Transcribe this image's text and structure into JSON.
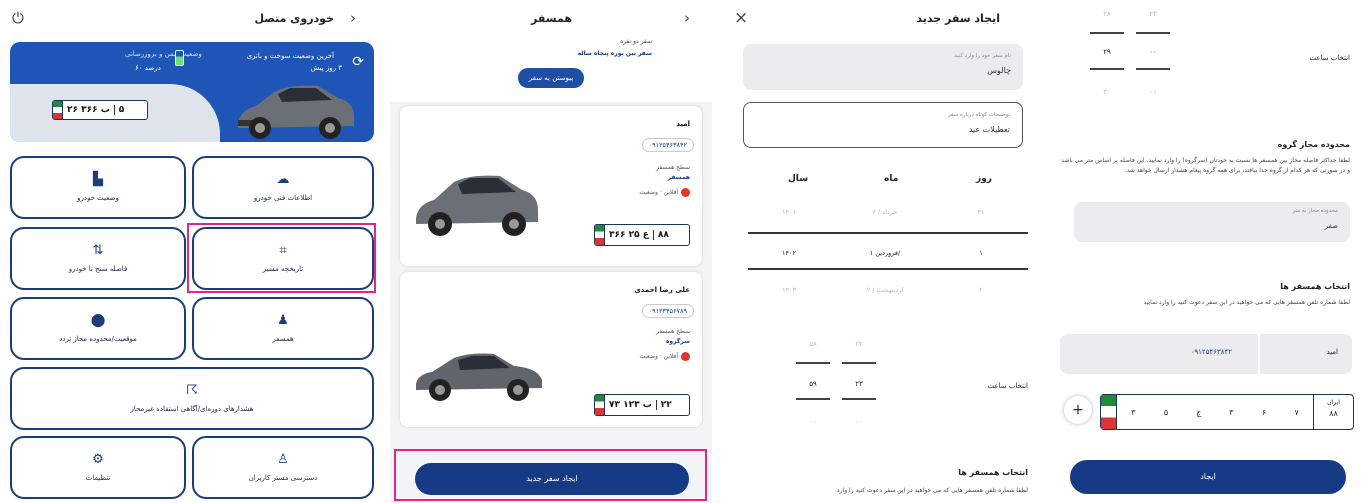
{
  "panel1": {
    "title": "خودروی متصل",
    "banner": {
      "fuel_label": "آخرین وضعیت سوخت و باتری",
      "model": "۳ روز پیش",
      "status": "وضعیت ایمن و بروزرسانی",
      "percent": "۶۰ درصد"
    },
    "plate": {
      "code": "۵",
      "main": "۲۶ ب ۳۶۶"
    },
    "tiles": [
      {
        "label": "اطلاعات فنی خودرو",
        "icon": "☁"
      },
      {
        "label": "وضعیت خودرو",
        "icon": "▙"
      },
      {
        "label": "تاریخچه مسیر",
        "icon": "⌗"
      },
      {
        "label": "فاصله سنج تا خودرو",
        "icon": "⇅"
      },
      {
        "label": "همسفر",
        "icon": "♟"
      },
      {
        "label": "موقعیت/محدوده مجاز تردد",
        "icon": "⬤"
      },
      {
        "label": "هشدارهای دوره‌ای/آگاهی استفاده غیرمجاز",
        "icon": "☈"
      },
      {
        "label": "دسترسی مستر کاربران",
        "icon": "♙"
      },
      {
        "label": "تنظیمات",
        "icon": "⚙"
      }
    ]
  },
  "panel2": {
    "title": "همسفر",
    "top_text": "سفر بین پوره پنجاه ساله",
    "top_sub": "سفر دو نفره",
    "top_btn": "پیوستن به سفر",
    "card1": {
      "name": "امید",
      "phone": "۰۹۱۲۵۴۶۳۸۴۲",
      "role_label": "سطح همسفر",
      "role": "همسفر",
      "status_label": "وضعیت",
      "status": "آفلاین",
      "plate": "۳۶۶ ع ۲۵",
      "plate_code": "۸۸"
    },
    "card2": {
      "name": "علی رضا احمدی",
      "phone": "۰۹۱۲۳۴۵۶۷۸۹",
      "role_label": "سطح همسفر",
      "role": "سرگروه",
      "status_label": "وضعیت",
      "status": "آفلاین",
      "plate": "۷۳ ب ۱۲۳",
      "plate_code": "۲۲"
    },
    "create_btn": "ایجاد سفر جدید"
  },
  "panel3": {
    "title": "ایجاد سفر جدید",
    "close": "×",
    "trip_name": {
      "label": "نام سفر خود را وارد کنید",
      "value": "چالوس"
    },
    "desc": {
      "label": "توضیحات کوتاه درباره سفر",
      "value": "تعطیلات عید"
    },
    "cols": {
      "day": "روز",
      "month": "ماه",
      "year": "سال"
    },
    "rows": [
      {
        "day": "۳۱",
        "month": "خرداد / ۶",
        "year": "۱۴۰۱"
      },
      {
        "day": "۱",
        "month": "فروردین ۱/",
        "year": "۱۴۰۲"
      },
      {
        "day": "۲",
        "month": "اردیبهشت / ۲",
        "year": "۱۴۰۳"
      }
    ],
    "time_label": "انتخاب ساعت",
    "time": {
      "h": [
        "۲۲",
        "۲۳",
        "۰۰"
      ],
      "m": [
        "۵۸",
        "۵۹",
        "۰۰"
      ]
    },
    "companions_title": "انتخاب همسفر ها",
    "companions_text": "لطفا شماره تلفن همسفر هایی که می خواهید در این سفر دعوت کنید را وارد"
  },
  "panel4": {
    "time": {
      "h": [
        "۲۳",
        "۰۰",
        "۰۱"
      ],
      "m": [
        "۲۸",
        "۲۹",
        "۳۰"
      ]
    },
    "time_label": "انتخاب ساعت",
    "group_title": "محدوده مجاز گروه",
    "group_text": "لطفا حداکثر فاصله مجاز بین همسفر ها نسبت به خودتان (سرگروه) را وارد نمایید. این فاصله بر اساس متر می باشد و در صورتی که هر کدام از گروه جدا بیافتد، برای همه گروه پیغام هشدار ارسال خواهد شد.",
    "distance": {
      "label": "محدوده مجاز به متر",
      "value": "صفر"
    },
    "companions_title": "انتخاب همسفر ها",
    "companions_text": "لطفا شماره تلفن همسفر هایی که می خواهید در این سفر دعوت کنید را وارد نمایید",
    "member": {
      "name": "امید",
      "phone": "۰۹۱۲۵۴۶۳۸۴۲"
    },
    "plate_digits": [
      "۷",
      "۶",
      "۳",
      "ج",
      "۵",
      "۳"
    ],
    "plate_region_label": "ایران",
    "plate_region": "۸۸",
    "add": "+",
    "submit": "ایجاد"
  }
}
